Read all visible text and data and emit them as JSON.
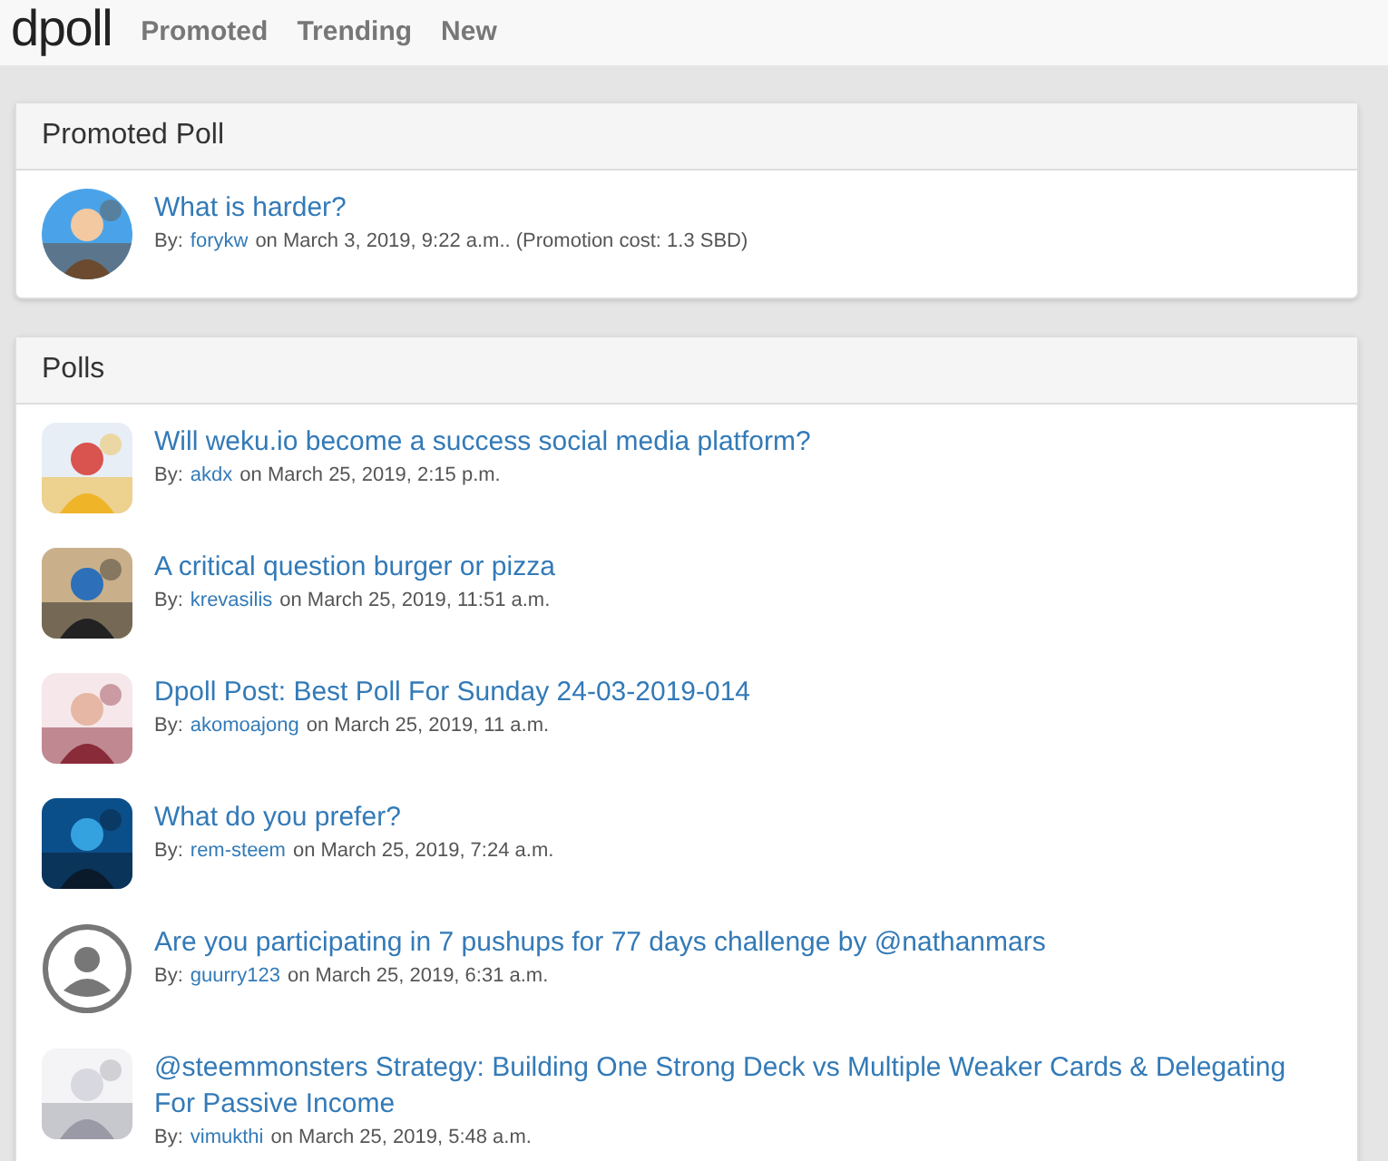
{
  "navbar": {
    "logo": "dpoll",
    "links": [
      {
        "label": "Promoted"
      },
      {
        "label": "Trending"
      },
      {
        "label": "New"
      }
    ]
  },
  "promoted": {
    "title": "Promoted Poll",
    "items": [
      {
        "kind": "picture",
        "question": "What is harder?",
        "by": "By:",
        "author": "forykw",
        "info": "on March 3, 2019, 9:22 a.m.. (Promotion cost: 1.3 SBD)"
      }
    ]
  },
  "polls": {
    "title": "Polls",
    "items": [
      {
        "kind": "picture",
        "question": "Will weku.io become a success social media platform?",
        "by": "By:",
        "author": "akdx",
        "info": "on March 25, 2019, 2:15 p.m."
      },
      {
        "kind": "picture",
        "question": "A critical question burger or pizza",
        "by": "By:",
        "author": "krevasilis",
        "info": "on March 25, 2019, 11:51 a.m."
      },
      {
        "kind": "picture",
        "question": "Dpoll Post: Best Poll For Sunday 24-03-2019-014",
        "by": "By:",
        "author": "akomoajong",
        "info": "on March 25, 2019, 11 a.m."
      },
      {
        "kind": "picture",
        "question": "What do you prefer?",
        "by": "By:",
        "author": "rem-steem",
        "info": "on March 25, 2019, 7:24 a.m."
      },
      {
        "kind": "default",
        "question": "Are you participating in 7 pushups for 77 days challenge by @nathanmars",
        "by": "By:",
        "author": "guurry123",
        "info": "on March 25, 2019, 6:31 a.m."
      },
      {
        "kind": "picture",
        "question": "@steemmonsters Strategy: Building One Strong Deck vs Multiple Weaker Cards & Delegating For Passive Income",
        "by": "By:",
        "author": "vimukthi",
        "info": "on March 25, 2019, 5:48 a.m."
      }
    ]
  }
}
